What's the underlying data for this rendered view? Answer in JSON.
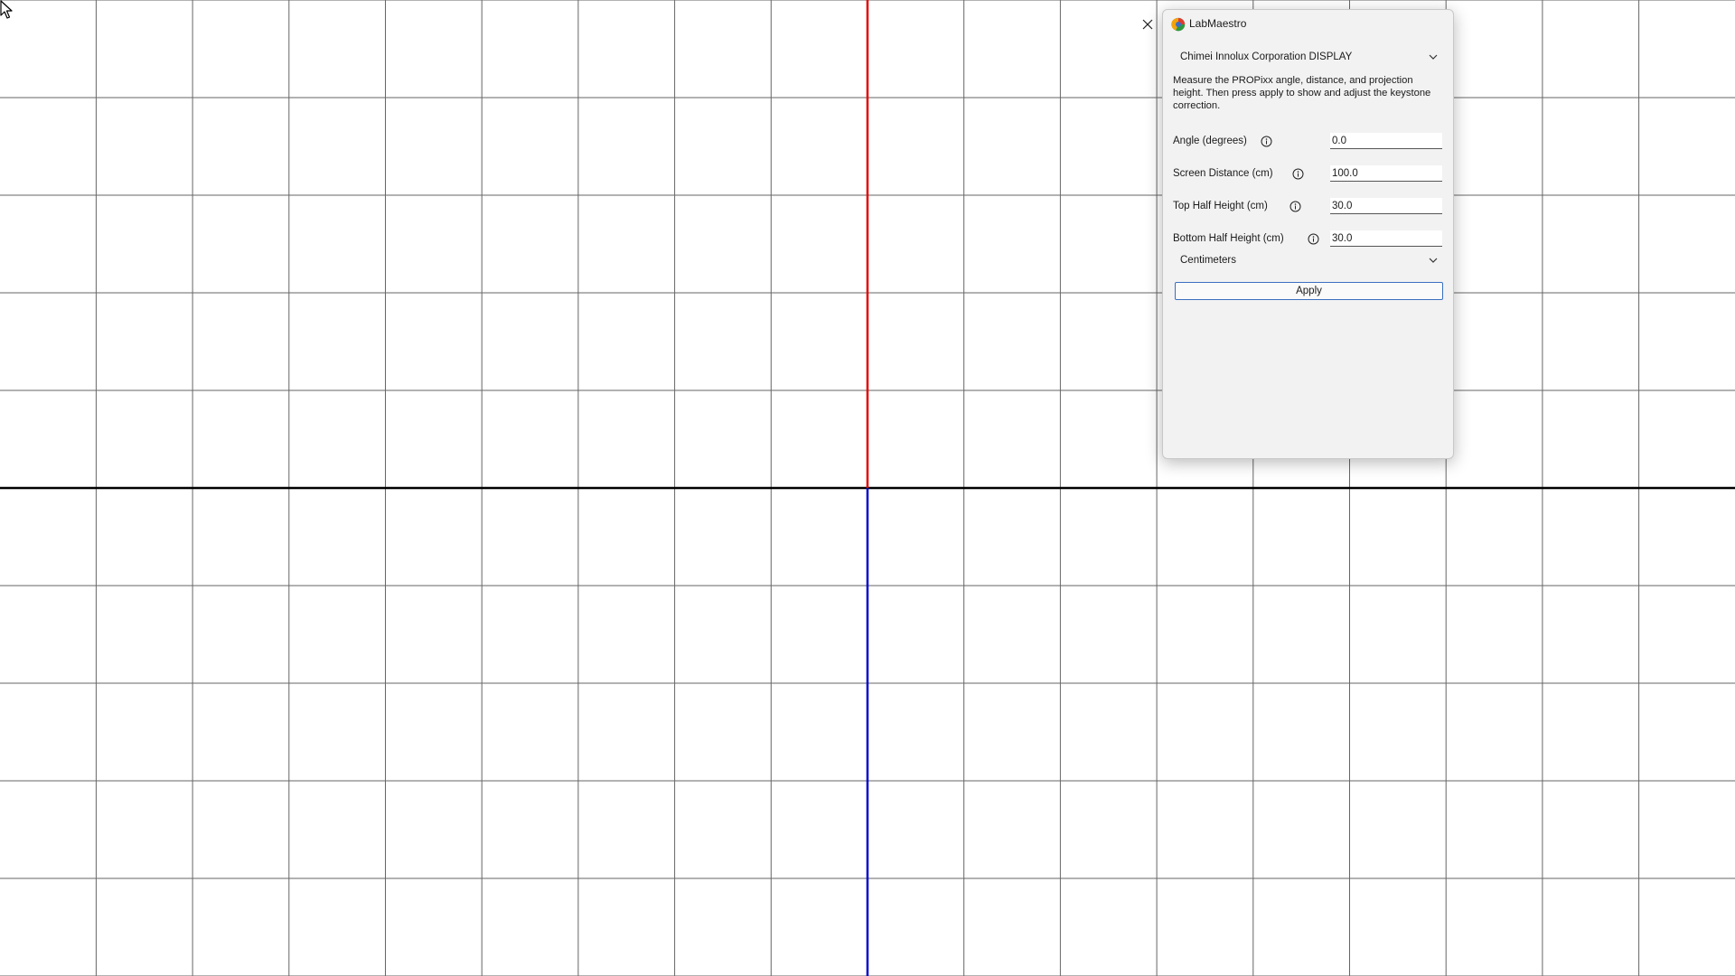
{
  "window": {
    "title": "LabMaestro",
    "app_icon": "labmaestro-logo-icon",
    "close_icon": "close-icon"
  },
  "display_select": {
    "value": "Chimei Innolux Corporation DISPLAY"
  },
  "description": "Measure the PROPixx angle, distance, and projection height. Then press apply to show and adjust the keystone correction.",
  "fields": [
    {
      "label": "Angle (degrees)",
      "value": "0.0"
    },
    {
      "label": "Screen Distance (cm)",
      "value": "100.0"
    },
    {
      "label": "Top Half Height (cm)",
      "value": "30.0"
    },
    {
      "label": "Bottom Half Height (cm)",
      "value": "30.0"
    }
  ],
  "units_select": {
    "value": "Centimeters"
  },
  "apply_label": "Apply",
  "grid": {
    "line_color": "#666666",
    "axis_horizontal_color": "#000000",
    "axis_vertical_top_color": "#e00000",
    "axis_vertical_bottom_color": "#0000cc"
  }
}
